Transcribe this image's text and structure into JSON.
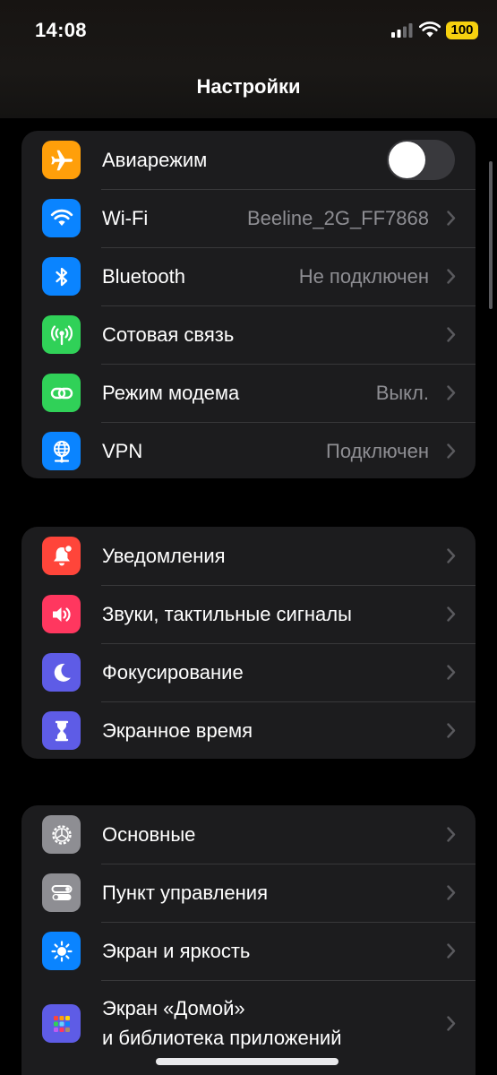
{
  "status_bar": {
    "time": "14:08",
    "battery": "100"
  },
  "nav": {
    "title": "Настройки"
  },
  "colors": {
    "orange": "#ff9f0a",
    "blue": "#0a84ff",
    "green": "#30d158",
    "red": "#ff453a",
    "pink": "#ff375f",
    "indigo": "#5e5ce6",
    "gray": "#8e8e93",
    "battery": "#f6d10f"
  },
  "groups": [
    {
      "rows": [
        {
          "label": "Авиарежим",
          "icon": "airplane-icon",
          "control": "toggle",
          "toggle_on": false
        },
        {
          "label": "Wi-Fi",
          "value": "Beeline_2G_FF7868",
          "icon": "wifi-icon"
        },
        {
          "label": "Bluetooth",
          "value": "Не подключен",
          "icon": "bluetooth-icon"
        },
        {
          "label": "Сотовая связь",
          "icon": "cellular-antenna-icon"
        },
        {
          "label": "Режим модема",
          "value": "Выкл.",
          "icon": "chain-link-icon"
        },
        {
          "label": "VPN",
          "value": "Подключен",
          "icon": "globe-network-icon"
        }
      ]
    },
    {
      "rows": [
        {
          "label": "Уведомления",
          "icon": "notification-bell-icon"
        },
        {
          "label": "Звуки, тактильные сигналы",
          "icon": "speaker-icon"
        },
        {
          "label": "Фокусирование",
          "icon": "crescent-moon-icon"
        },
        {
          "label": "Экранное время",
          "icon": "hourglass-icon"
        }
      ]
    },
    {
      "rows": [
        {
          "label": "Основные",
          "icon": "gear-icon"
        },
        {
          "label": "Пункт управления",
          "icon": "toggles-icon"
        },
        {
          "label": "Экран и яркость",
          "icon": "sun-icon"
        },
        {
          "label_line1": "Экран «Домой»",
          "label_line2": "и библиотека приложений",
          "icon": "app-grid-icon"
        }
      ]
    }
  ]
}
